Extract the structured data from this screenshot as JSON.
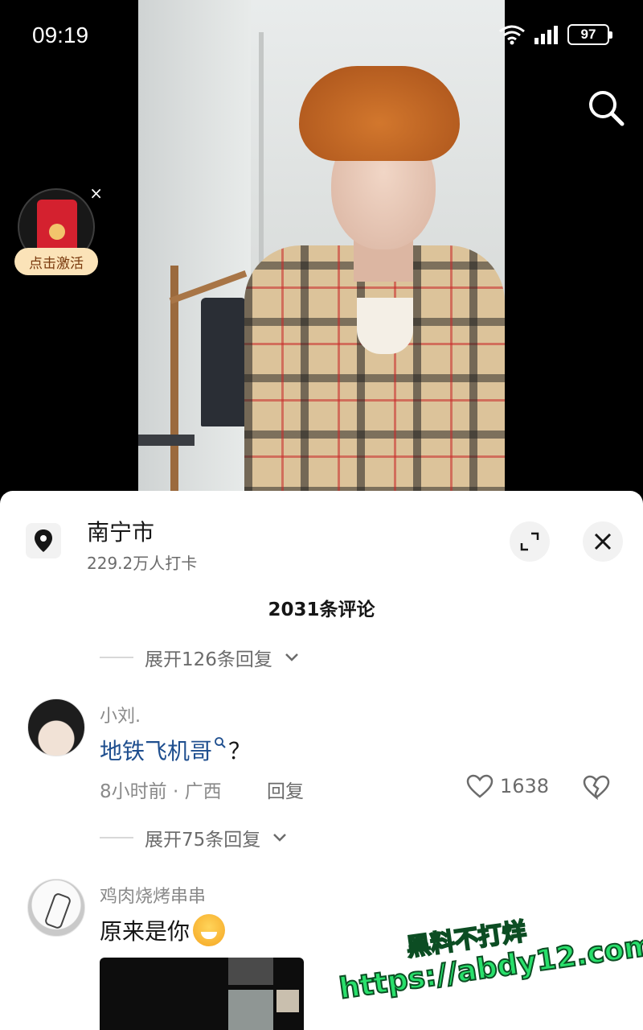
{
  "status_bar": {
    "time": "09:19",
    "battery": "97"
  },
  "redpacket": {
    "label": "点击激活",
    "close": "×"
  },
  "location": {
    "name": "南宁市",
    "checkins": "229.2万人打卡"
  },
  "comments_header": {
    "count_label": "2031条评论"
  },
  "expand_replies": [
    {
      "label": "展开126条回复"
    },
    {
      "label": "展开75条回复"
    }
  ],
  "comments": [
    {
      "user": "小刘.",
      "link_text": "地铁飞机哥",
      "suffix": "？",
      "meta": "8小时前 · 广西",
      "reply_label": "回复",
      "likes": "1638"
    },
    {
      "user": "鸡肉烧烤串串",
      "text": "原来是你"
    }
  ],
  "watermark": {
    "line1": "黑料不打烊",
    "line2": "https://abdy12.com"
  },
  "icons": {
    "search": "search-icon",
    "location": "location-pin-icon",
    "expand": "expand-icon",
    "close": "close-icon",
    "like": "heart-icon",
    "dislike": "broken-heart-icon"
  }
}
